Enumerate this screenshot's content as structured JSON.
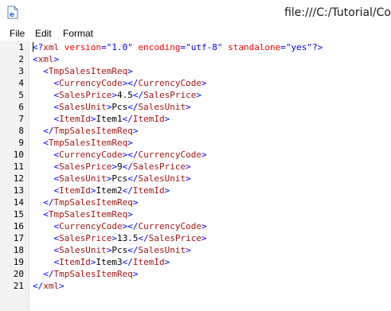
{
  "window": {
    "title": "file:///C:/Tutorial/Co",
    "icon": "ie-page-icon"
  },
  "menu": [
    "File",
    "Edit",
    "Format"
  ],
  "lines": [
    {
      "n": "1",
      "parts": [
        {
          "t": "<?",
          "c": "br"
        },
        {
          "t": "xml",
          "c": "tag"
        },
        {
          "t": " version",
          "c": "attr"
        },
        {
          "t": "=",
          "c": "br"
        },
        {
          "t": "\"1.0\"",
          "c": "val"
        },
        {
          "t": " encoding",
          "c": "attr"
        },
        {
          "t": "=",
          "c": "br"
        },
        {
          "t": "\"utf-8\"",
          "c": "val"
        },
        {
          "t": " standalone",
          "c": "attr"
        },
        {
          "t": "=",
          "c": "br"
        },
        {
          "t": "\"yes\"",
          "c": "val"
        },
        {
          "t": "?>",
          "c": "br"
        }
      ]
    },
    {
      "n": "2",
      "parts": [
        {
          "t": "<",
          "c": "br"
        },
        {
          "t": "xml",
          "c": "tag"
        },
        {
          "t": ">",
          "c": "br"
        }
      ]
    },
    {
      "n": "3",
      "parts": [
        {
          "t": "  ",
          "c": "txt"
        },
        {
          "t": "<",
          "c": "br"
        },
        {
          "t": "TmpSalesItemReq",
          "c": "tag"
        },
        {
          "t": ">",
          "c": "br"
        }
      ]
    },
    {
      "n": "4",
      "parts": [
        {
          "t": "    ",
          "c": "txt"
        },
        {
          "t": "<",
          "c": "br"
        },
        {
          "t": "CurrencyCode",
          "c": "tag"
        },
        {
          "t": "></",
          "c": "br"
        },
        {
          "t": "CurrencyCode",
          "c": "tag"
        },
        {
          "t": ">",
          "c": "br"
        }
      ]
    },
    {
      "n": "5",
      "parts": [
        {
          "t": "    ",
          "c": "txt"
        },
        {
          "t": "<",
          "c": "br"
        },
        {
          "t": "SalesPrice",
          "c": "tag"
        },
        {
          "t": ">",
          "c": "br"
        },
        {
          "t": "4.5",
          "c": "txt"
        },
        {
          "t": "</",
          "c": "br"
        },
        {
          "t": "SalesPrice",
          "c": "tag"
        },
        {
          "t": ">",
          "c": "br"
        }
      ]
    },
    {
      "n": "6",
      "parts": [
        {
          "t": "    ",
          "c": "txt"
        },
        {
          "t": "<",
          "c": "br"
        },
        {
          "t": "SalesUnit",
          "c": "tag"
        },
        {
          "t": ">",
          "c": "br"
        },
        {
          "t": "Pcs",
          "c": "txt"
        },
        {
          "t": "</",
          "c": "br"
        },
        {
          "t": "SalesUnit",
          "c": "tag"
        },
        {
          "t": ">",
          "c": "br"
        }
      ]
    },
    {
      "n": "7",
      "parts": [
        {
          "t": "    ",
          "c": "txt"
        },
        {
          "t": "<",
          "c": "br"
        },
        {
          "t": "ItemId",
          "c": "tag"
        },
        {
          "t": ">",
          "c": "br"
        },
        {
          "t": "Item1",
          "c": "txt"
        },
        {
          "t": "</",
          "c": "br"
        },
        {
          "t": "ItemId",
          "c": "tag"
        },
        {
          "t": ">",
          "c": "br"
        }
      ]
    },
    {
      "n": "8",
      "parts": [
        {
          "t": "  ",
          "c": "txt"
        },
        {
          "t": "</",
          "c": "br"
        },
        {
          "t": "TmpSalesItemReq",
          "c": "tag"
        },
        {
          "t": ">",
          "c": "br"
        }
      ]
    },
    {
      "n": "9",
      "parts": [
        {
          "t": "  ",
          "c": "txt"
        },
        {
          "t": "<",
          "c": "br"
        },
        {
          "t": "TmpSalesItemReq",
          "c": "tag"
        },
        {
          "t": ">",
          "c": "br"
        }
      ]
    },
    {
      "n": "10",
      "parts": [
        {
          "t": "    ",
          "c": "txt"
        },
        {
          "t": "<",
          "c": "br"
        },
        {
          "t": "CurrencyCode",
          "c": "tag"
        },
        {
          "t": "></",
          "c": "br"
        },
        {
          "t": "CurrencyCode",
          "c": "tag"
        },
        {
          "t": ">",
          "c": "br"
        }
      ]
    },
    {
      "n": "11",
      "parts": [
        {
          "t": "    ",
          "c": "txt"
        },
        {
          "t": "<",
          "c": "br"
        },
        {
          "t": "SalesPrice",
          "c": "tag"
        },
        {
          "t": ">",
          "c": "br"
        },
        {
          "t": "9",
          "c": "txt"
        },
        {
          "t": "</",
          "c": "br"
        },
        {
          "t": "SalesPrice",
          "c": "tag"
        },
        {
          "t": ">",
          "c": "br"
        }
      ]
    },
    {
      "n": "12",
      "parts": [
        {
          "t": "    ",
          "c": "txt"
        },
        {
          "t": "<",
          "c": "br"
        },
        {
          "t": "SalesUnit",
          "c": "tag"
        },
        {
          "t": ">",
          "c": "br"
        },
        {
          "t": "Pcs",
          "c": "txt"
        },
        {
          "t": "</",
          "c": "br"
        },
        {
          "t": "SalesUnit",
          "c": "tag"
        },
        {
          "t": ">",
          "c": "br"
        }
      ]
    },
    {
      "n": "13",
      "parts": [
        {
          "t": "    ",
          "c": "txt"
        },
        {
          "t": "<",
          "c": "br"
        },
        {
          "t": "ItemId",
          "c": "tag"
        },
        {
          "t": ">",
          "c": "br"
        },
        {
          "t": "Item2",
          "c": "txt"
        },
        {
          "t": "</",
          "c": "br"
        },
        {
          "t": "ItemId",
          "c": "tag"
        },
        {
          "t": ">",
          "c": "br"
        }
      ]
    },
    {
      "n": "14",
      "parts": [
        {
          "t": "  ",
          "c": "txt"
        },
        {
          "t": "</",
          "c": "br"
        },
        {
          "t": "TmpSalesItemReq",
          "c": "tag"
        },
        {
          "t": ">",
          "c": "br"
        }
      ]
    },
    {
      "n": "15",
      "parts": [
        {
          "t": "  ",
          "c": "txt"
        },
        {
          "t": "<",
          "c": "br"
        },
        {
          "t": "TmpSalesItemReq",
          "c": "tag"
        },
        {
          "t": ">",
          "c": "br"
        }
      ]
    },
    {
      "n": "16",
      "parts": [
        {
          "t": "    ",
          "c": "txt"
        },
        {
          "t": "<",
          "c": "br"
        },
        {
          "t": "CurrencyCode",
          "c": "tag"
        },
        {
          "t": "></",
          "c": "br"
        },
        {
          "t": "CurrencyCode",
          "c": "tag"
        },
        {
          "t": ">",
          "c": "br"
        }
      ]
    },
    {
      "n": "17",
      "parts": [
        {
          "t": "    ",
          "c": "txt"
        },
        {
          "t": "<",
          "c": "br"
        },
        {
          "t": "SalesPrice",
          "c": "tag"
        },
        {
          "t": ">",
          "c": "br"
        },
        {
          "t": "13.5",
          "c": "txt"
        },
        {
          "t": "</",
          "c": "br"
        },
        {
          "t": "SalesPrice",
          "c": "tag"
        },
        {
          "t": ">",
          "c": "br"
        }
      ]
    },
    {
      "n": "18",
      "parts": [
        {
          "t": "    ",
          "c": "txt"
        },
        {
          "t": "<",
          "c": "br"
        },
        {
          "t": "SalesUnit",
          "c": "tag"
        },
        {
          "t": ">",
          "c": "br"
        },
        {
          "t": "Pcs",
          "c": "txt"
        },
        {
          "t": "</",
          "c": "br"
        },
        {
          "t": "SalesUnit",
          "c": "tag"
        },
        {
          "t": ">",
          "c": "br"
        }
      ]
    },
    {
      "n": "19",
      "parts": [
        {
          "t": "    ",
          "c": "txt"
        },
        {
          "t": "<",
          "c": "br"
        },
        {
          "t": "ItemId",
          "c": "tag"
        },
        {
          "t": ">",
          "c": "br"
        },
        {
          "t": "Item3",
          "c": "txt"
        },
        {
          "t": "</",
          "c": "br"
        },
        {
          "t": "ItemId",
          "c": "tag"
        },
        {
          "t": ">",
          "c": "br"
        }
      ]
    },
    {
      "n": "20",
      "parts": [
        {
          "t": "  ",
          "c": "txt"
        },
        {
          "t": "</",
          "c": "br"
        },
        {
          "t": "TmpSalesItemReq",
          "c": "tag"
        },
        {
          "t": ">",
          "c": "br"
        }
      ]
    },
    {
      "n": "21",
      "parts": [
        {
          "t": "</",
          "c": "br"
        },
        {
          "t": "xml",
          "c": "tag"
        },
        {
          "t": ">",
          "c": "br"
        }
      ]
    }
  ]
}
